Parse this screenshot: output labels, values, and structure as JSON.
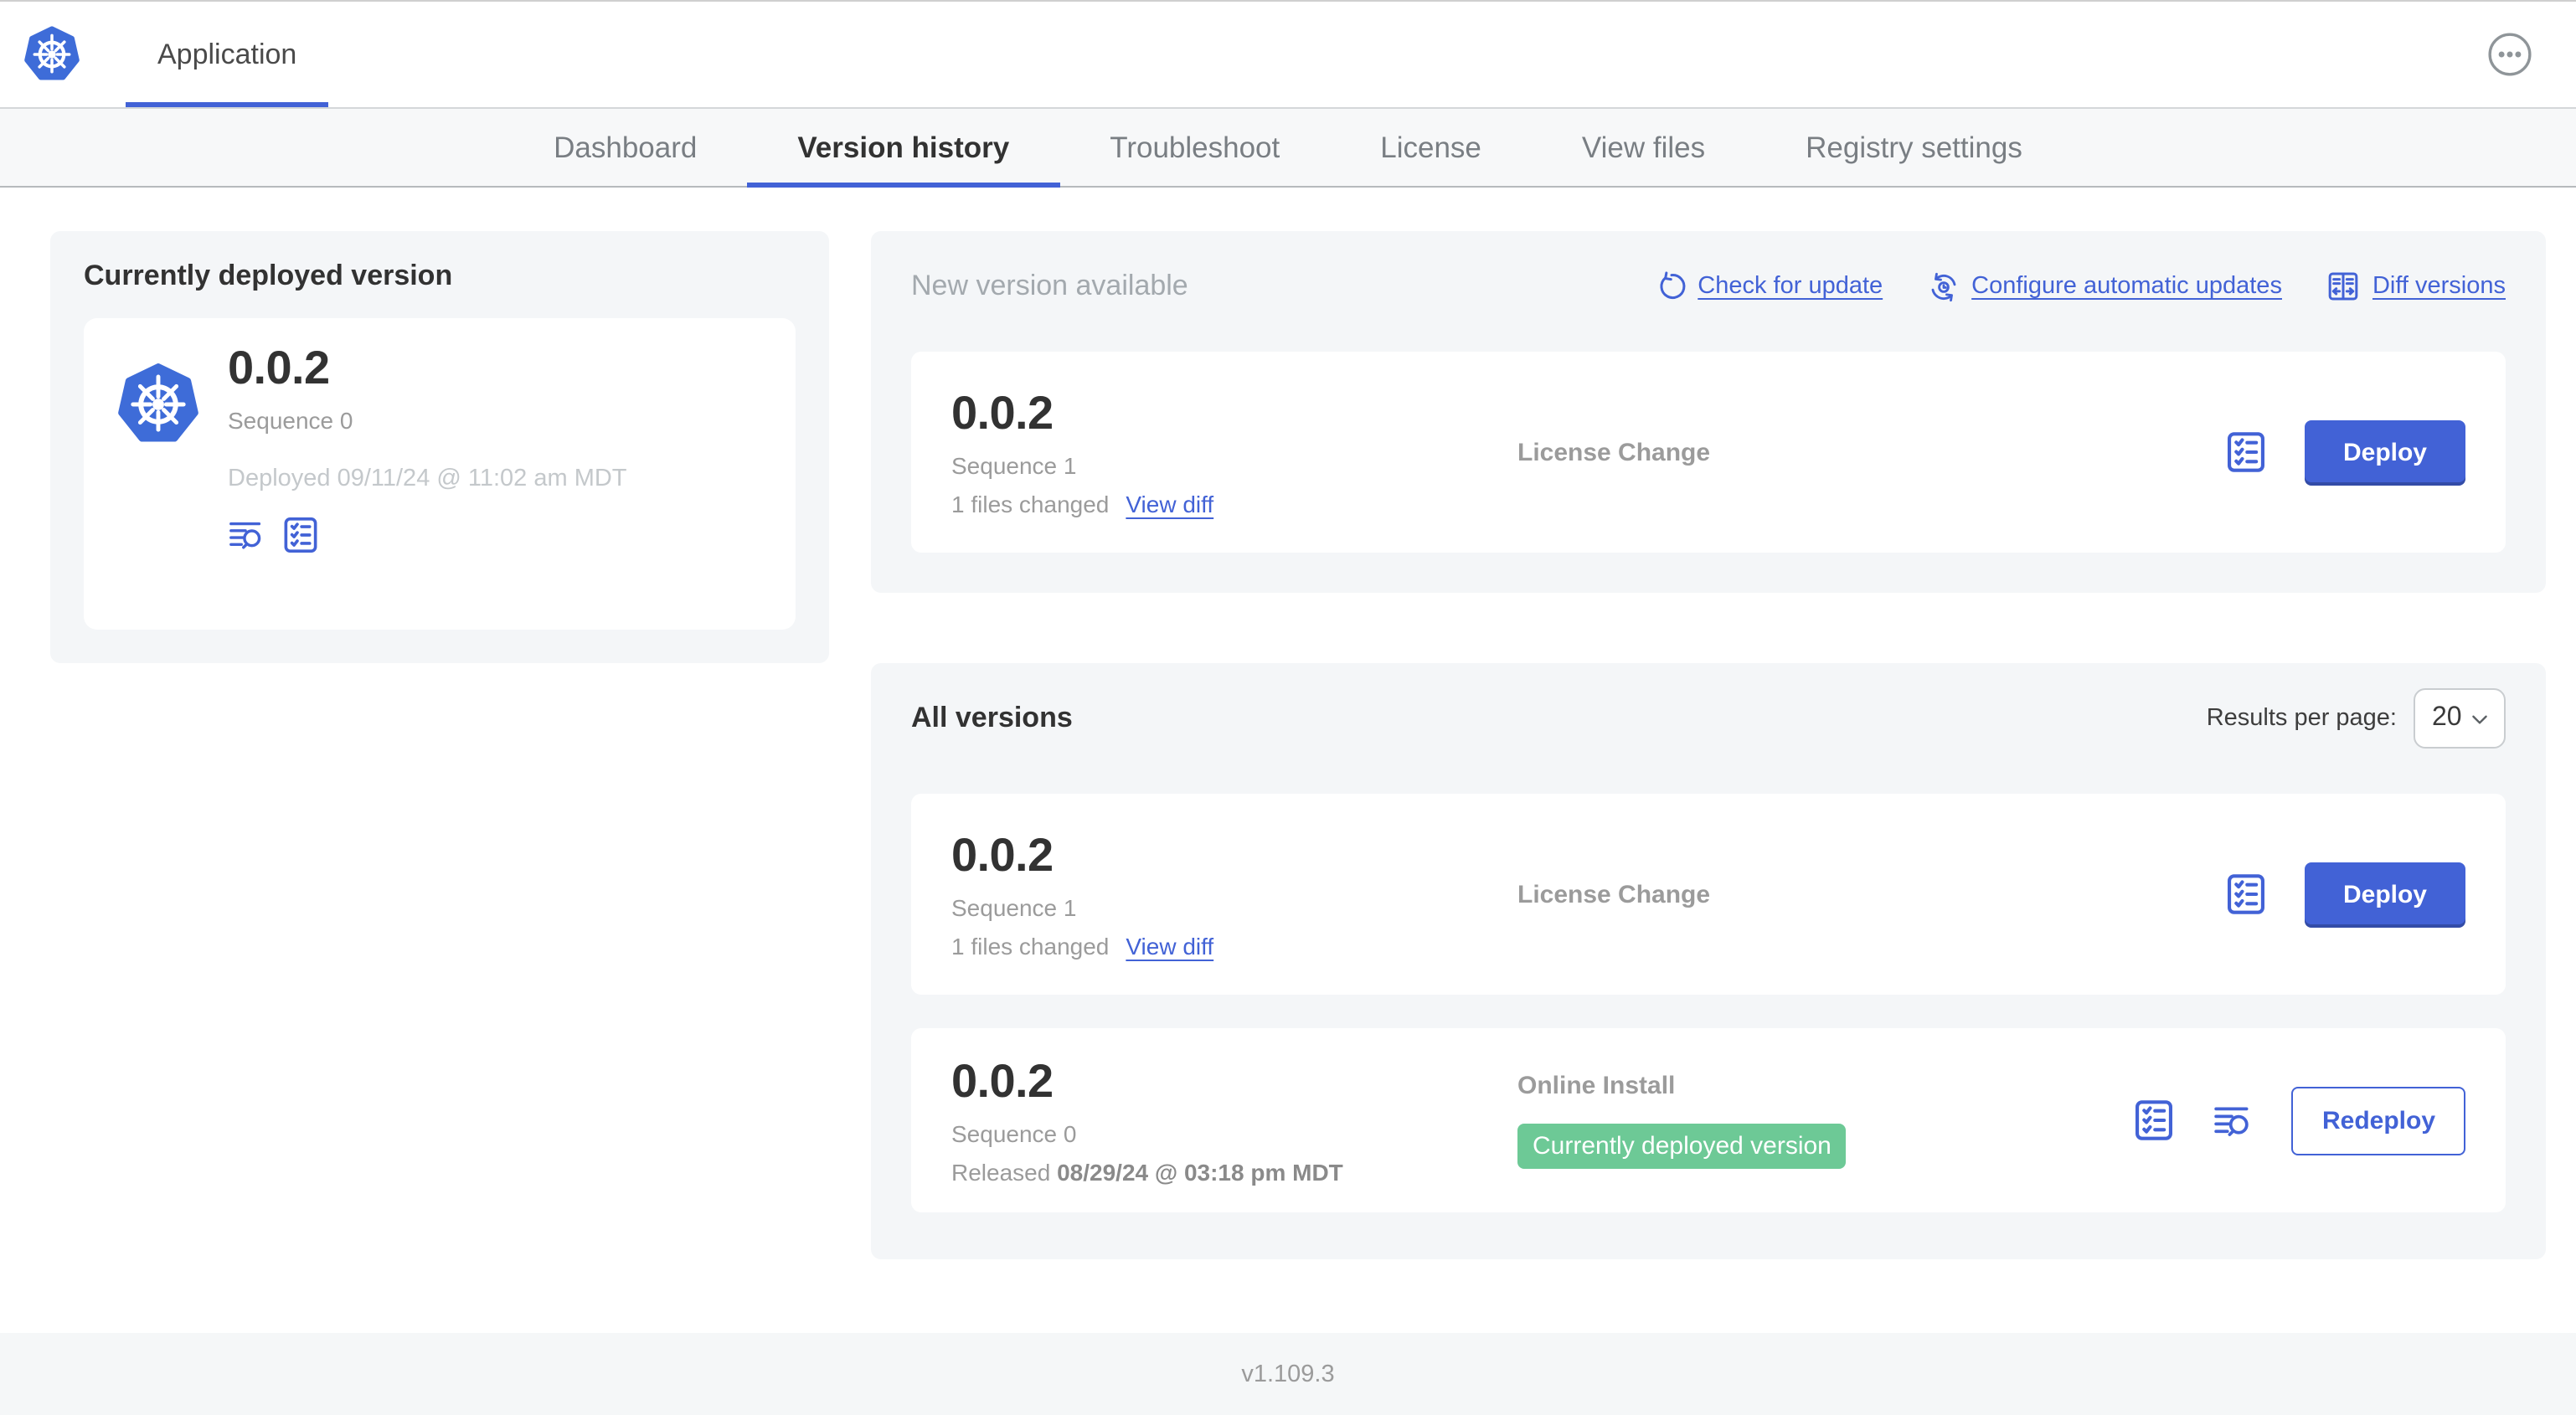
{
  "header": {
    "app_tab_label": "Application"
  },
  "nav": {
    "tabs": [
      {
        "label": "Dashboard",
        "active": false
      },
      {
        "label": "Version history",
        "active": true
      },
      {
        "label": "Troubleshoot",
        "active": false
      },
      {
        "label": "License",
        "active": false
      },
      {
        "label": "View files",
        "active": false
      },
      {
        "label": "Registry settings",
        "active": false
      }
    ]
  },
  "deployed_panel": {
    "title": "Currently deployed version",
    "version": "0.0.2",
    "sequence": "Sequence 0",
    "deployed_timestamp": "Deployed 09/11/24 @ 11:02 am MDT"
  },
  "new_version_panel": {
    "title": "New version available",
    "actions": {
      "check_for_update": "Check for update",
      "configure_automatic_updates": "Configure automatic updates",
      "diff_versions": "Diff versions"
    },
    "card": {
      "version": "0.0.2",
      "sequence": "Sequence 1",
      "files_changed": "1 files changed",
      "view_diff_label": "View diff",
      "source": "License Change",
      "deploy_label": "Deploy"
    }
  },
  "all_versions_panel": {
    "title": "All versions",
    "results_per_page_label": "Results per page:",
    "results_per_page_value": "20",
    "card1": {
      "version": "0.0.2",
      "sequence": "Sequence 1",
      "files_changed": "1 files changed",
      "view_diff_label": "View diff",
      "source": "License Change",
      "deploy_label": "Deploy"
    },
    "card2": {
      "version": "0.0.2",
      "sequence": "Sequence 0",
      "released_prefix": "Released ",
      "released_date": "08/29/24 @ 03:18 pm MDT",
      "source": "Online Install",
      "badge": "Currently deployed version",
      "redeploy_label": "Redeploy"
    }
  },
  "footer": {
    "app_version": "v1.109.3"
  },
  "icons": {
    "brand": "kubernetes-logo-icon",
    "more": "ellipsis-icon",
    "check_update": "refresh-icon",
    "auto_updates": "scheduled-sync-clock-icon",
    "diff": "diff-columns-icon",
    "preflight": "checklist-icon",
    "logs": "log-search-icon",
    "select": "chevron-down-icon"
  },
  "colors": {
    "primary_blue": "#4262d6",
    "logo_blue": "#3e6cd8",
    "badge_green": "#6dc996",
    "panel_gray": "#f4f6f8",
    "text_dark": "#323232",
    "text_gray": "#9b9b9b",
    "text_light_gray": "#c4c8cb"
  }
}
